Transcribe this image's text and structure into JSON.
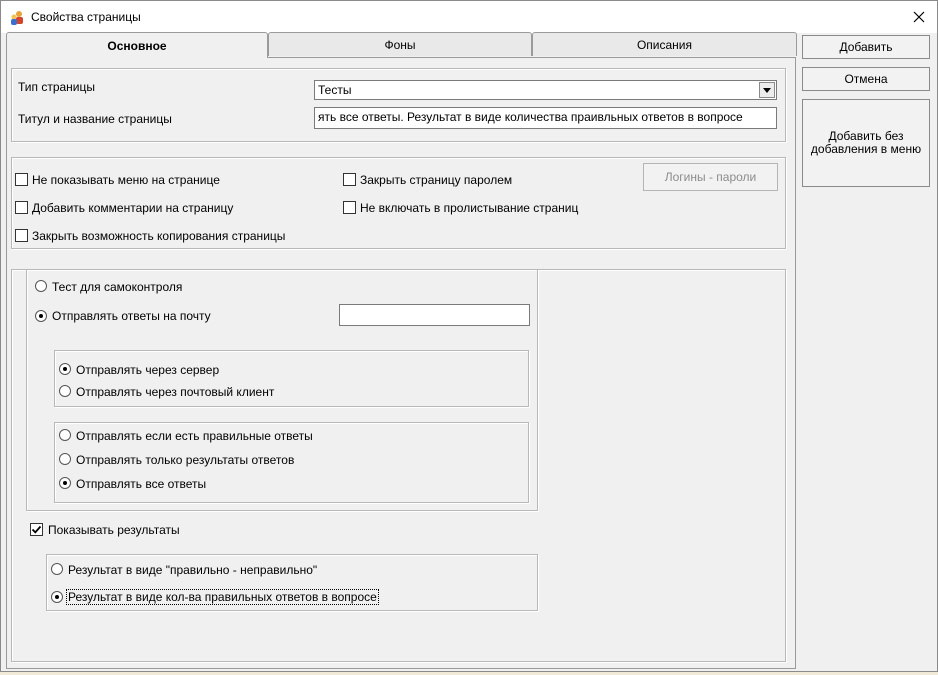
{
  "window": {
    "title": "Свойства страницы"
  },
  "tabs": [
    {
      "label": "Основное",
      "active": true
    },
    {
      "label": "Фоны",
      "active": false
    },
    {
      "label": "Описания",
      "active": false
    }
  ],
  "buttons": {
    "add": "Добавить",
    "cancel": "Отмена",
    "add_no_menu": "Добавить без добавления в меню",
    "logins_passwords": "Логины - пароли"
  },
  "page_type": {
    "label": "Тип страницы",
    "value": "Тесты"
  },
  "page_title": {
    "label": "Титул и название страницы",
    "value": "ять все ответы. Результат в виде количества праивльных ответов в вопросе"
  },
  "options": {
    "hide_menu": {
      "label": "Не показывать меню на странице",
      "checked": false
    },
    "add_comments": {
      "label": "Добавить комментарии на страницу",
      "checked": false
    },
    "disable_copy": {
      "label": "Закрыть возможность копирования страницы",
      "checked": false
    },
    "password_protect": {
      "label": "Закрыть страницу паролем",
      "checked": false
    },
    "exclude_paging": {
      "label": "Не включать в пролистывание страниц",
      "checked": false
    }
  },
  "test_mode": {
    "self_control": {
      "label": "Тест для самоконтроля",
      "selected": false
    },
    "send_email": {
      "label": "Отправлять ответы на почту",
      "selected": true
    },
    "email_value": ""
  },
  "send_method": {
    "server": {
      "label": "Отправлять через сервер",
      "selected": true
    },
    "mail_client": {
      "label": "Отправлять через почтовый клиент",
      "selected": false
    }
  },
  "send_what": {
    "if_correct": {
      "label": "Отправлять если есть правильные ответы",
      "selected": false
    },
    "results_only": {
      "label": "Отправлять только результаты ответов",
      "selected": false
    },
    "all_answers": {
      "label": "Отправлять все ответы",
      "selected": true
    }
  },
  "show_results": {
    "label": "Показывать результаты",
    "checked": true
  },
  "result_format": {
    "right_wrong": {
      "label": "Результат в виде \"правильно - неправильно\"",
      "selected": false
    },
    "count_correct": {
      "label": "Результат в виде кол-ва правильных ответов в вопросе",
      "selected": true
    }
  },
  "colors": {
    "window_bg": "#f0f0f0",
    "desktop_bg": "#f2ead8"
  }
}
